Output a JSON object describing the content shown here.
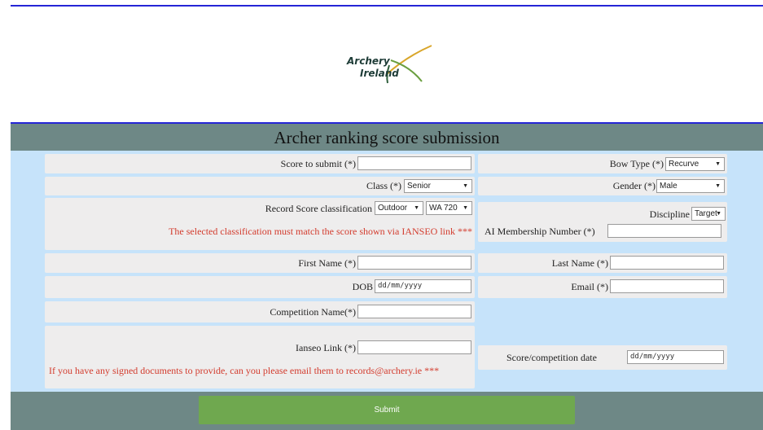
{
  "brand": {
    "line1": "Archery",
    "line2": "Ireland"
  },
  "title": "Archer ranking score submission",
  "fields": {
    "score_label": "Score to submit (*)",
    "bow_type_label": "Bow Type (*)",
    "bow_type_value": "Recurve",
    "class_label": "Class (*)",
    "class_value": "Senior",
    "gender_label": "Gender (*)",
    "gender_value": "Male",
    "record_label": "Record Score classification",
    "record_env_value": "Outdoor",
    "record_round_value": "WA 720",
    "classification_note": "The selected classification must match the score shown via IANSEO link ***",
    "discipline_label": "Discipline",
    "discipline_value": "Target",
    "membership_label": "AI Membership Number (*)",
    "first_name_label": "First Name (*)",
    "last_name_label": "Last Name (*)",
    "dob_label": "DOB",
    "dob_placeholder": "dd/mm/yyyy",
    "email_label": "Email (*)",
    "competition_label": "Competition Name(*)",
    "ianseo_label": "Ianseo Link (*)",
    "documents_note": "If you have any signed documents to provide, can you please email them to records@archery.ie ***",
    "date_label": "Score/competition date",
    "date_placeholder": "dd/mm/yyyy"
  },
  "submit_label": "Submit",
  "colors": {
    "header_bar": "#6e8886",
    "form_background": "#c6e3fa",
    "cell_background": "#eeeded",
    "note_text": "#d33c2e",
    "submit_button": "#6fa84f",
    "rule_line": "#2525d6"
  }
}
